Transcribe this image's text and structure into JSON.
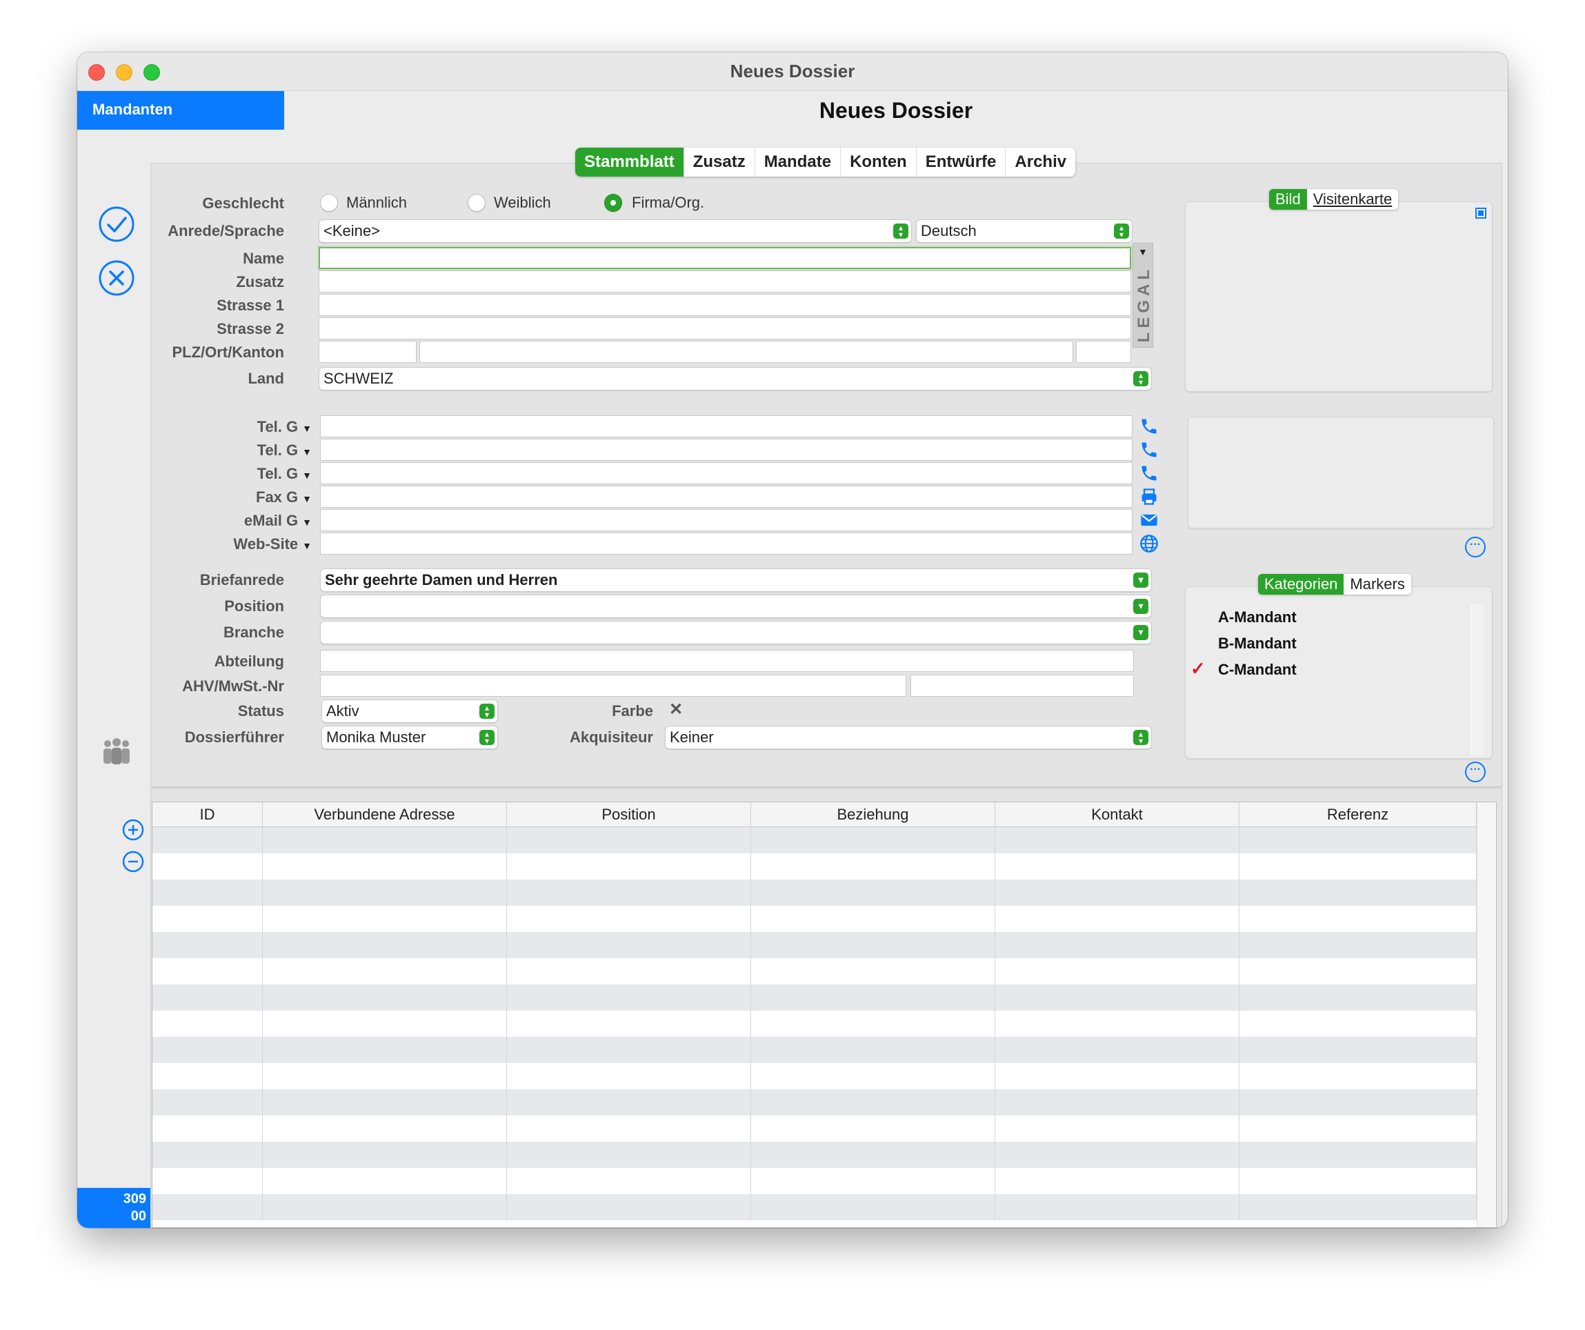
{
  "window": {
    "title": "Neues Dossier"
  },
  "sidebar": {
    "tab_label": "Mandanten",
    "counter_line1": "309",
    "counter_line2": "00"
  },
  "page": {
    "title": "Neues Dossier"
  },
  "tabs": [
    {
      "label": "Stammblatt",
      "active": true
    },
    {
      "label": "Zusatz",
      "active": false
    },
    {
      "label": "Mandate",
      "active": false
    },
    {
      "label": "Konten",
      "active": false
    },
    {
      "label": "Entwürfe",
      "active": false
    },
    {
      "label": "Archiv",
      "active": false
    }
  ],
  "form": {
    "geschlecht": {
      "label": "Geschlecht",
      "options": [
        "Männlich",
        "Weiblich",
        "Firma/Org."
      ],
      "selected": "Firma/Org."
    },
    "anrede": {
      "label": "Anrede/Sprache",
      "value": "<Keine>",
      "sprache": "Deutsch"
    },
    "name": {
      "label": "Name",
      "value": ""
    },
    "zusatz": {
      "label": "Zusatz",
      "value": ""
    },
    "strasse1": {
      "label": "Strasse 1",
      "value": ""
    },
    "strasse2": {
      "label": "Strasse 2",
      "value": ""
    },
    "plz": {
      "label": "PLZ/Ort/Kanton",
      "plz": "",
      "ort": "",
      "kanton": ""
    },
    "land": {
      "label": "Land",
      "value": "SCHWEIZ"
    },
    "legal": "LEGAL",
    "contacts": [
      {
        "label": "Tel. G",
        "value": "",
        "icon": "phone-icon"
      },
      {
        "label": "Tel. G",
        "value": "",
        "icon": "phone-icon"
      },
      {
        "label": "Tel. G",
        "value": "",
        "icon": "phone-icon"
      },
      {
        "label": "Fax G",
        "value": "",
        "icon": "fax-icon"
      },
      {
        "label": "eMail G",
        "value": "",
        "icon": "email-icon"
      },
      {
        "label": "Web-Site",
        "value": "",
        "icon": "globe-icon"
      }
    ],
    "briefanrede": {
      "label": "Briefanrede",
      "value": "Sehr geehrte Damen und Herren"
    },
    "position": {
      "label": "Position",
      "value": ""
    },
    "branche": {
      "label": "Branche",
      "value": ""
    },
    "abteilung": {
      "label": "Abteilung",
      "value": ""
    },
    "ahv": {
      "label": "AHV/MwSt.-Nr",
      "value": "",
      "value2": ""
    },
    "status": {
      "label": "Status",
      "value": "Aktiv"
    },
    "farbe": {
      "label": "Farbe",
      "value": "✕"
    },
    "dossierfuehrer": {
      "label": "Dossierführer",
      "value": "Monika Muster"
    },
    "akquisiteur": {
      "label": "Akquisiteur",
      "value": "Keiner"
    }
  },
  "image_panel": {
    "tabs": [
      "Bild",
      "Visitenkarte"
    ],
    "active": "Bild"
  },
  "categories_panel": {
    "tabs": [
      "Kategorien",
      "Markers"
    ],
    "active": "Kategorien",
    "items": [
      {
        "label": "A-Mandant",
        "checked": false
      },
      {
        "label": "B-Mandant",
        "checked": false
      },
      {
        "label": "C-Mandant",
        "checked": true
      }
    ]
  },
  "table": {
    "columns": [
      "ID",
      "Verbundene Adresse",
      "Position",
      "Beziehung",
      "Kontakt",
      "Referenz"
    ],
    "rows": []
  },
  "colors": {
    "accent": "#0a7aff",
    "green": "#2aa32a",
    "check": "#d51d1d"
  }
}
